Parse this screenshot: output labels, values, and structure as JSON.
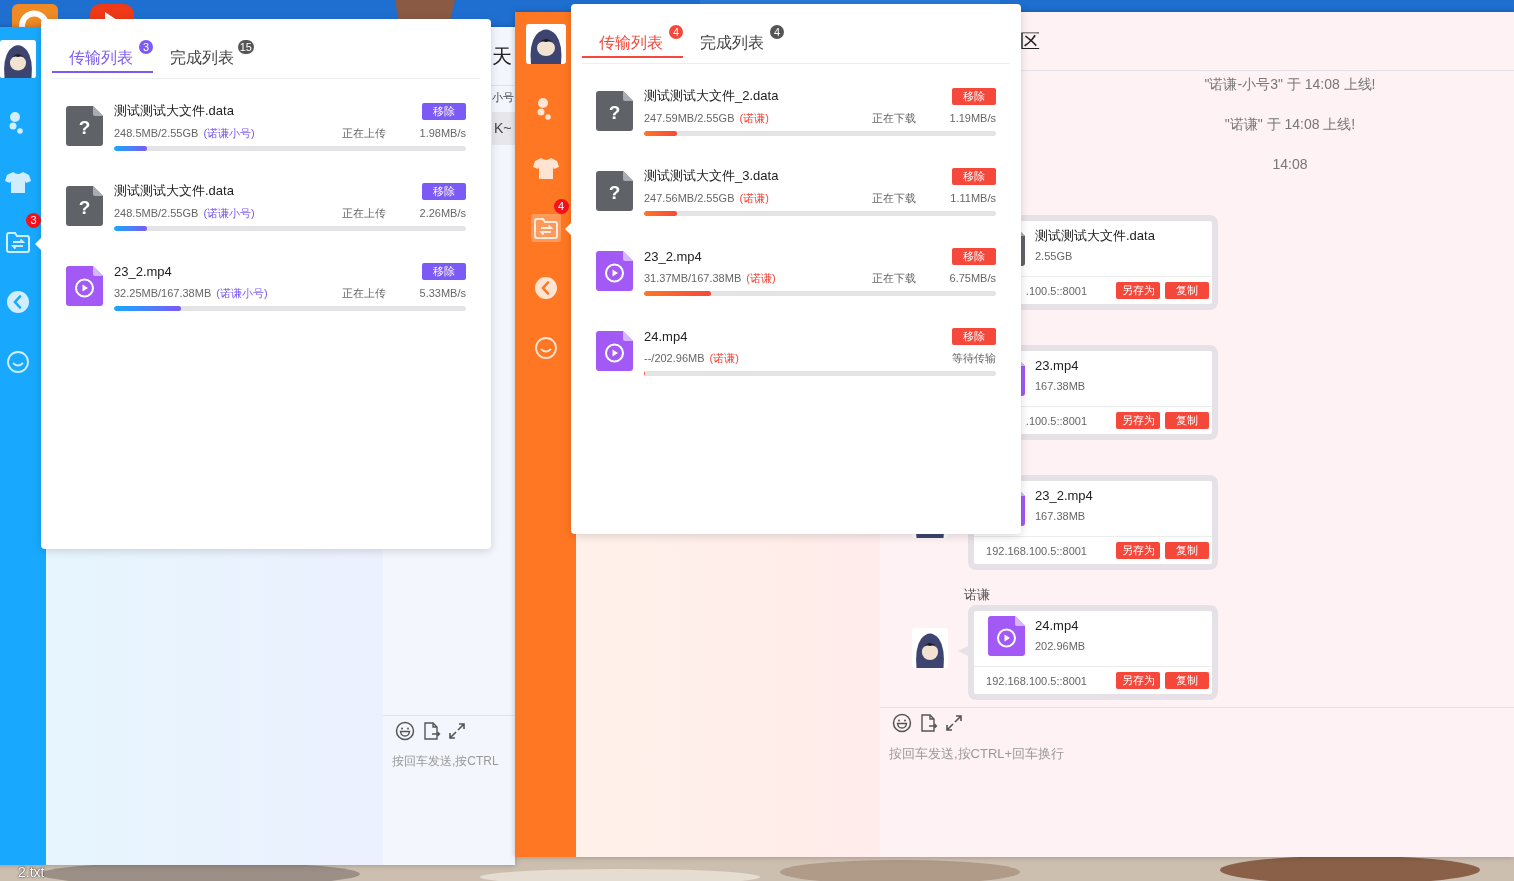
{
  "desktop": {
    "icons": [
      {
        "kind": "swirl"
      },
      {
        "kind": "play"
      }
    ],
    "file_label": "2.txt"
  },
  "windows": [
    {
      "sidebar": {
        "color": "#18a9fe",
        "items": [
          {
            "kind": "chat",
            "selected": false
          },
          {
            "kind": "wardrobe",
            "selected": false
          },
          {
            "kind": "transfer",
            "selected": false,
            "badge": "3"
          },
          {
            "kind": "back",
            "selected": false
          },
          {
            "kind": "emoji",
            "selected": false
          }
        ]
      },
      "chat": {
        "title": "天",
        "preview_lines": [
          {
            "text": "小号",
            "highlighted": false
          },
          {
            "text": "K~",
            "highlighted": true
          }
        ],
        "placeholder": "按回车发送,按CTRL"
      },
      "transfer_popover": {
        "color": "#7b5af5",
        "tabs": [
          {
            "label": "传输列表",
            "badge": "3",
            "selected": true
          },
          {
            "label": "完成列表",
            "badge": "15",
            "selected": false
          }
        ],
        "items": [
          {
            "kind": "unknown",
            "icon_text": "?",
            "name": "测试测试大文件.data",
            "size": "248.5MB/2.55GB",
            "user": "(诺谦小号)",
            "status": "正在上传",
            "speed": "1.98MB/s",
            "action": "移除",
            "level": 0.094
          },
          {
            "kind": "unknown",
            "icon_text": "?",
            "name": "测试测试大文件.data",
            "size": "248.5MB/2.55GB",
            "user": "(诺谦小号)",
            "status": "正在上传",
            "speed": "2.26MB/s",
            "action": "移除",
            "level": 0.094
          },
          {
            "kind": "video",
            "name": "23_2.mp4",
            "size": "32.25MB/167.38MB",
            "user": "(诺谦小号)",
            "status": "正在上传",
            "speed": "5.33MB/s",
            "action": "移除",
            "level": 0.19
          }
        ]
      }
    },
    {
      "sidebar": {
        "color": "#ff7722",
        "items": [
          {
            "kind": "chat",
            "selected": false
          },
          {
            "kind": "wardrobe",
            "selected": false
          },
          {
            "kind": "transfer",
            "selected": true,
            "badge": "4"
          },
          {
            "kind": "back",
            "selected": false
          },
          {
            "kind": "emoji",
            "selected": false
          }
        ]
      },
      "chat": {
        "title": "区",
        "notes": [
          "\"诺谦-小号3\" 于 14:08 上线!",
          "\"诺谦\" 于 14:08 上线!",
          "14:08"
        ],
        "messages": [
          {
            "kind": "unknown",
            "name": "测试测试大文件.data",
            "size": "2.55GB",
            "address": ".100.5::8001",
            "actions": [
              "另存为",
              "复制"
            ]
          },
          {
            "kind": "video",
            "name": "23.mp4",
            "size": "167.38MB",
            "address": ".100.5::8001",
            "actions": [
              "另存为",
              "复制"
            ]
          },
          {
            "avatar": true,
            "kind": "video",
            "name": "23_2.mp4",
            "size": "167.38MB",
            "address": "192.168.100.5::8001",
            "actions": [
              "另存为",
              "复制"
            ]
          },
          {
            "sender": "诺谦",
            "avatar": true,
            "kind": "video",
            "name": "24.mp4",
            "size": "202.96MB",
            "address": "192.168.100.5::8001",
            "actions": [
              "另存为",
              "复制"
            ]
          }
        ],
        "placeholder": "按回车发送,按CTRL+回车换行"
      },
      "transfer_popover": {
        "color": "#f5483b",
        "tabs": [
          {
            "label": "传输列表",
            "badge": "4",
            "selected": true
          },
          {
            "label": "完成列表",
            "badge": "4",
            "selected": false
          }
        ],
        "items": [
          {
            "kind": "unknown",
            "icon_text": "?",
            "name": "测试测试大文件_2.data",
            "size": "247.59MB/2.55GB",
            "user": "(诺谦)",
            "status": "正在下载",
            "speed": "1.19MB/s",
            "action": "移除",
            "level": 0.095
          },
          {
            "kind": "unknown",
            "icon_text": "?",
            "name": "测试测试大文件_3.data",
            "size": "247.56MB/2.55GB",
            "user": "(诺谦)",
            "status": "正在下载",
            "speed": "1.11MB/s",
            "action": "移除",
            "level": 0.095
          },
          {
            "kind": "video",
            "name": "23_2.mp4",
            "size": "31.37MB/167.38MB",
            "user": "(诺谦)",
            "status": "正在下载",
            "speed": "6.75MB/s",
            "action": "移除",
            "level": 0.19
          },
          {
            "kind": "video",
            "name": "24.mp4",
            "size": "--/202.96MB",
            "user": "(诺谦)",
            "status": "等待传输",
            "action": "移除",
            "level": 0
          }
        ]
      }
    }
  ]
}
